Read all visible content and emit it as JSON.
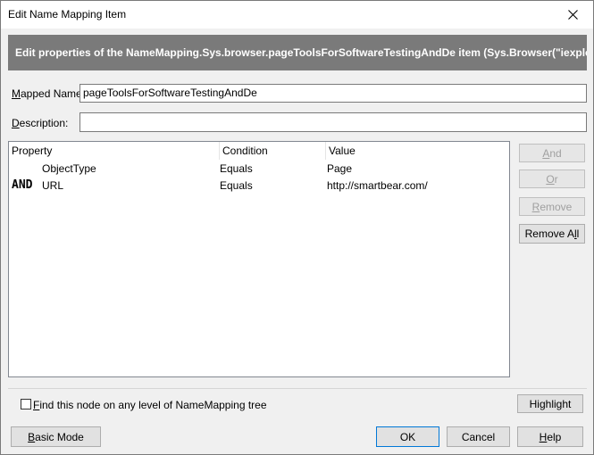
{
  "window": {
    "title": "Edit Name Mapping Item"
  },
  "header": {
    "text": "Edit properties of the NameMapping.Sys.browser.pageToolsForSoftwareTestingAndDe item (Sys.Browser(\"iexplor"
  },
  "fields": {
    "mapped_name": {
      "label_pre": "",
      "label_key": "M",
      "label_post": "apped Name:",
      "value": "pageToolsForSoftwareTestingAndDe"
    },
    "description": {
      "label_pre": "",
      "label_key": "D",
      "label_post": "escription:",
      "value": ""
    }
  },
  "grid": {
    "columns": [
      "Property",
      "Condition",
      "Value"
    ],
    "rows": [
      {
        "operator": "",
        "property": "ObjectType",
        "condition": "Equals",
        "value": "Page"
      },
      {
        "operator": "AND",
        "property": "URL",
        "condition": "Equals",
        "value": "http://smartbear.com/"
      }
    ]
  },
  "side_buttons": {
    "and": {
      "key": "A",
      "rest": "nd"
    },
    "or": {
      "key": "O",
      "rest": "r"
    },
    "remove": {
      "key": "R",
      "rest": "emove"
    },
    "remove_all": {
      "pre": "Remove A",
      "key": "l",
      "post": "l"
    }
  },
  "checkbox": {
    "pre": "",
    "key": "F",
    "post": "ind this node on any level of NameMapping tree",
    "checked": false
  },
  "buttons": {
    "highlight": {
      "pre": "Hi",
      "key": "g",
      "post": "hlight"
    },
    "basic_mode": {
      "pre": "",
      "key": "B",
      "post": "asic Mode"
    },
    "ok": "OK",
    "cancel": "Cancel",
    "help": {
      "pre": "",
      "key": "H",
      "post": "elp"
    }
  }
}
